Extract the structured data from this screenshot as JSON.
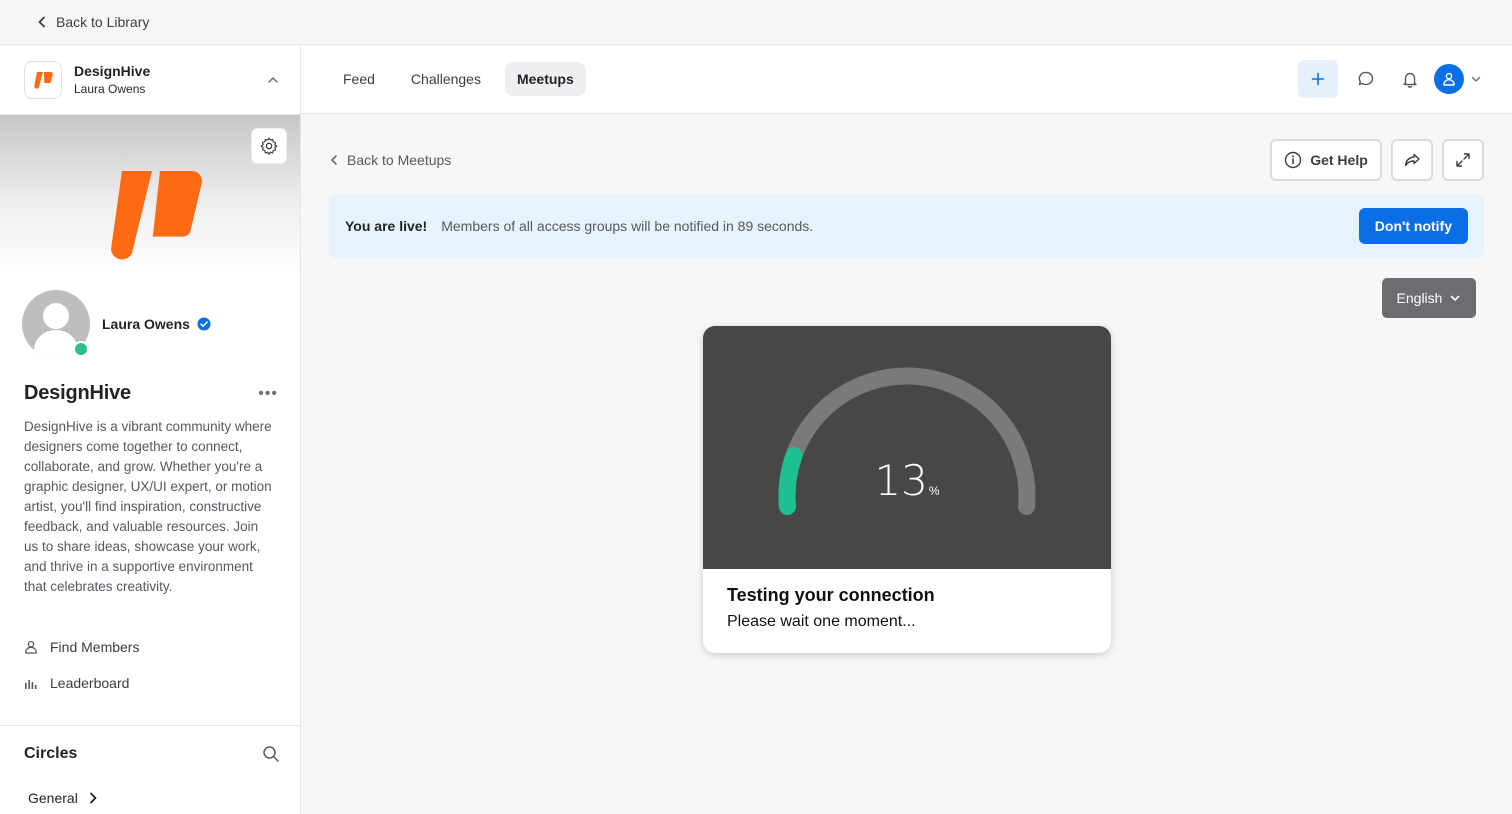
{
  "topbar": {
    "back_label": "Back to Library"
  },
  "switcher": {
    "title": "DesignHive",
    "subtitle": "Laura Owens"
  },
  "profile": {
    "name": "Laura Owens",
    "online": true,
    "verified": true
  },
  "community": {
    "name": "DesignHive",
    "description": "DesignHive is a vibrant community where designers come together to connect, collaborate, and grow. Whether you're a graphic designer, UX/UI expert, or motion artist, you'll find inspiration, constructive feedback, and valuable resources. Join us to share ideas, showcase your work, and thrive in a supportive environment that celebrates creativity."
  },
  "side_links": [
    {
      "label": "Find Members",
      "icon": "person-icon"
    },
    {
      "label": "Leaderboard",
      "icon": "bar-chart-icon"
    }
  ],
  "circles": {
    "title": "Circles",
    "items": [
      {
        "label": "General"
      }
    ]
  },
  "tabs": [
    {
      "label": "Feed",
      "active": false
    },
    {
      "label": "Challenges",
      "active": false
    },
    {
      "label": "Meetups",
      "active": true
    }
  ],
  "meetup": {
    "back_label": "Back to Meetups",
    "help_label": "Get Help",
    "banner_strong": "You are live!",
    "banner_text": "Members of all access groups will be notified in 89 seconds.",
    "dont_notify_label": "Don't notify",
    "language": "English"
  },
  "connection_test": {
    "progress_value": 13,
    "unit": "%",
    "title": "Testing your connection",
    "subtitle": "Please wait one moment..."
  },
  "colors": {
    "brand": "#ff6a13",
    "accent": "#0a6ee6",
    "gauge_fill": "#1fbf94",
    "gauge_track": "#7a7a7a",
    "online": "#2fbf86"
  }
}
